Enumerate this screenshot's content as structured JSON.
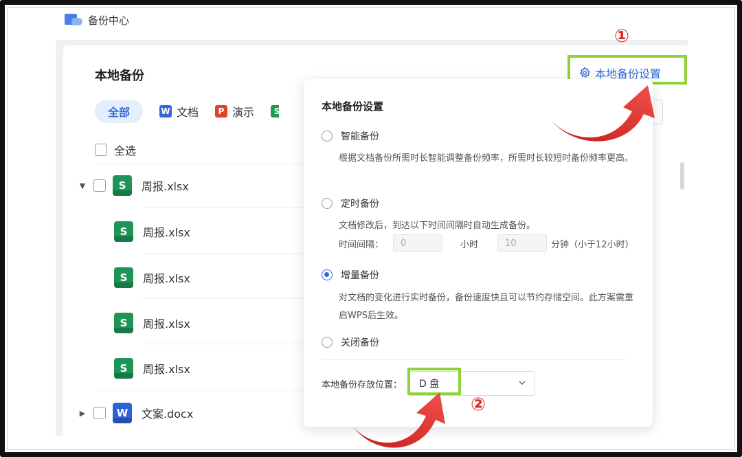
{
  "app": {
    "title": "备份中心"
  },
  "panel": {
    "title": "本地备份",
    "settings_link": "本地备份设置",
    "tabs": [
      {
        "label": "全部",
        "active": true
      },
      {
        "label": "文档",
        "icon": "W"
      },
      {
        "label": "演示",
        "icon": "P"
      }
    ],
    "select_all": "全选",
    "files": [
      {
        "name": "周报.xlsx",
        "icon": "S",
        "expanded": true,
        "level": 0
      },
      {
        "name": "周报.xlsx",
        "icon": "S",
        "level": 1
      },
      {
        "name": "周报.xlsx",
        "icon": "S",
        "level": 1
      },
      {
        "name": "周报.xlsx",
        "icon": "S",
        "level": 1
      },
      {
        "name": "周报.xlsx",
        "icon": "S",
        "level": 1
      },
      {
        "name": "文案.docx",
        "icon": "W",
        "expanded": false,
        "level": 0
      }
    ]
  },
  "popup": {
    "title": "本地备份设置",
    "options": [
      {
        "label": "智能备份",
        "selected": false,
        "desc": "根据文档备份所需时长智能调整备份频率，所需时长较短时备份频率更高。"
      },
      {
        "label": "定时备份",
        "selected": false,
        "desc": "文档修改后，到达以下时间间隔时自动生成备份。"
      },
      {
        "label": "增量备份",
        "selected": true,
        "desc": "对文档的变化进行实时备份，备份速度快且可以节约存储空间。此方案需重启WPS后生效。"
      },
      {
        "label": "关闭备份",
        "selected": false
      }
    ],
    "interval": {
      "label": "时间间隔：",
      "hours_value": "0",
      "hours_unit": "小时",
      "minutes_value": "10",
      "minutes_unit": "分钟（小于12小时）"
    },
    "location_label": "本地备份存放位置：",
    "location_value": "D 盘"
  },
  "annotations": {
    "step1": "①",
    "step2": "②"
  },
  "colors": {
    "accent": "#2e6bd8",
    "highlight": "#8fd13a",
    "arrow": "#d82a2a"
  }
}
